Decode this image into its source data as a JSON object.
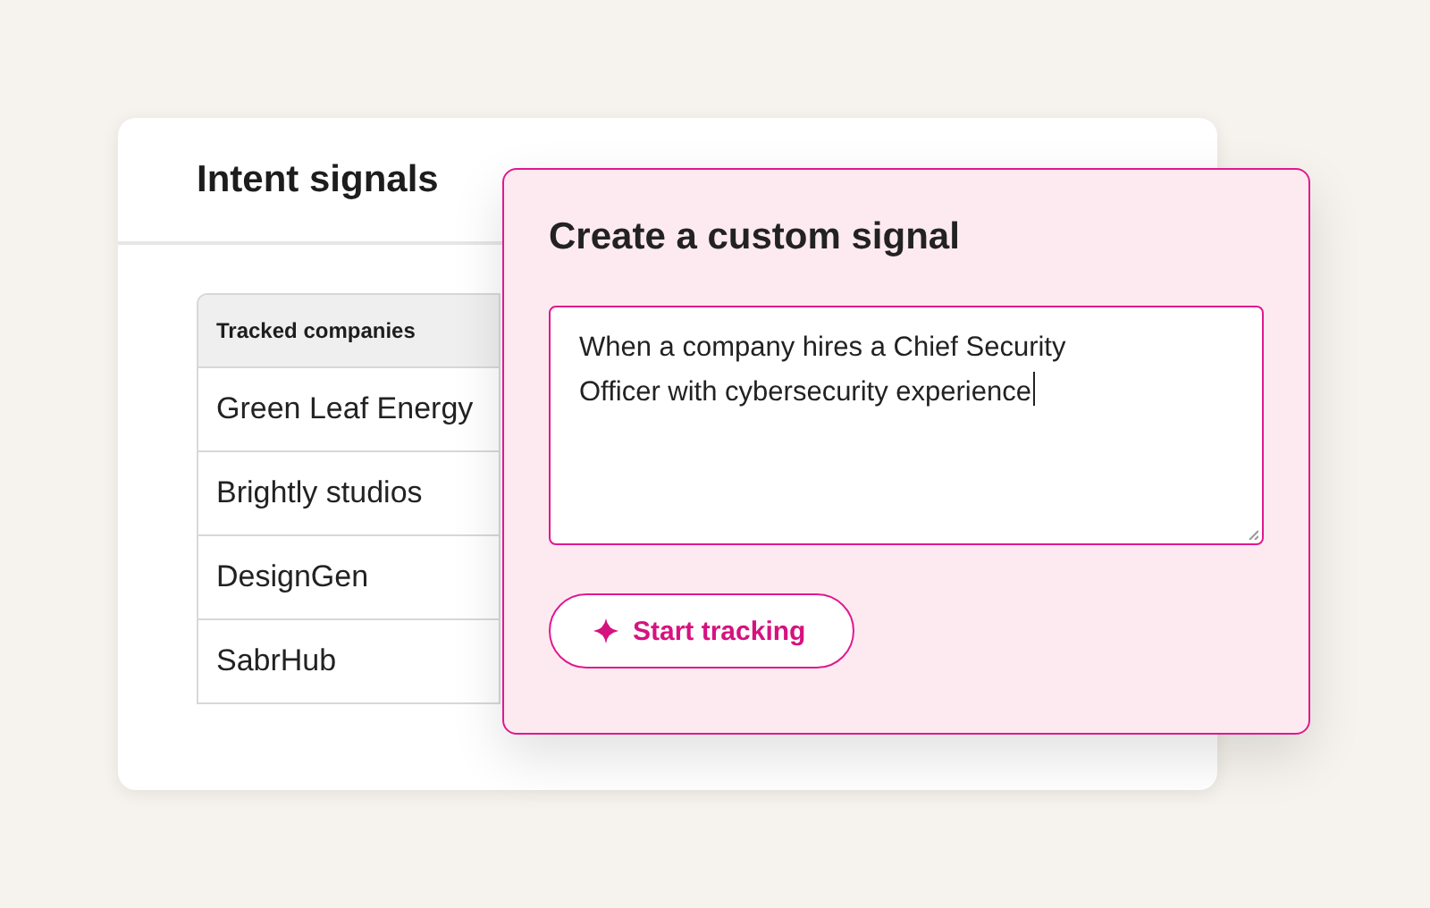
{
  "card": {
    "title": "Intent signals"
  },
  "table": {
    "columns": [
      "Tracked companies"
    ],
    "rows": [
      [
        "Green Leaf Energy"
      ],
      [
        "Brightly studios"
      ],
      [
        "DesignGen"
      ],
      [
        "SabrHub"
      ]
    ]
  },
  "dialog": {
    "title": "Create a custom signal",
    "field": {
      "value": "When a company hires a Chief Security Officer with cybersecurity experience"
    },
    "button": "Start tracking"
  }
}
